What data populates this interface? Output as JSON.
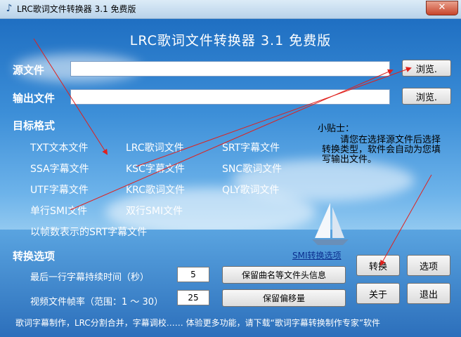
{
  "window": {
    "title": "LRC歌词文件转换器 3.1 免费版",
    "close_glyph": "✕",
    "icon": "music-note-icon"
  },
  "header": {
    "title": "LRC歌词文件转换器 3.1 免费版"
  },
  "source": {
    "label": "源文件",
    "value": "",
    "browse_label": "浏览."
  },
  "output": {
    "label": "输出文件",
    "value": "",
    "browse_label": "浏览."
  },
  "formats": {
    "label": "目标格式",
    "items": [
      "TXT文本文件",
      "LRC歌词文件",
      "SRT字幕文件",
      "SSA字幕文件",
      "KSC字幕文件",
      "SNC歌词文件",
      "UTF字幕文件",
      "KRC歌词文件",
      "QLY歌词文件",
      "单行SMI文件",
      "双行SMI文件",
      "以帧数表示的SRT字幕文件"
    ]
  },
  "tip": {
    "title": "小贴士：",
    "text": "请您在选择源文件后选择转换类型，软件会自动为您填写输出文件。"
  },
  "options": {
    "label": "转换选项",
    "smi_link": "SMI转换选项",
    "last_line_label": "最后一行字幕持续时间（秒）",
    "last_line_value": "5",
    "frame_rate_label": "视频文件帧率（范围：1 ～ 30）",
    "frame_rate_value": "25",
    "keep_header_button": "保留曲名等文件头信息",
    "keep_offset_button": "保留偏移量"
  },
  "actions": {
    "convert": "转换",
    "options": "选项",
    "about": "关于",
    "exit": "退出"
  },
  "status": {
    "text": "歌词字幕制作，LRC分割合并，字幕调校…… 体验更多功能，请下载“歌词字幕转换制作专家”软件"
  },
  "colors": {
    "background_top": "#1f6fc2",
    "background_mid": "#9ed0f2",
    "annotation_arrow": "#e0201c",
    "link": "#0a2e8f"
  }
}
